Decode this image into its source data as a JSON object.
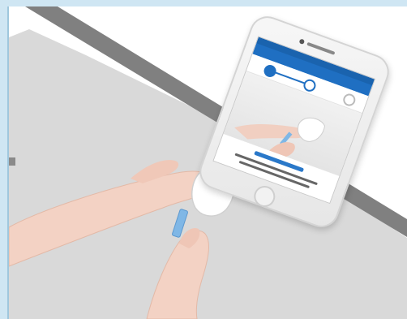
{
  "scene": {
    "colors": {
      "frame": "#cfe6f3",
      "frame_line": "#9fc7dd",
      "floor": "#d9d9d9",
      "edge_band": "#7f7f7f",
      "surface": "#ffffff",
      "skin": "#f3d2c4",
      "strip": "#7fb7e6",
      "app_blue": "#1f6fc2"
    },
    "app_steps": {
      "total": 3,
      "completed": 1,
      "current": 2
    }
  }
}
